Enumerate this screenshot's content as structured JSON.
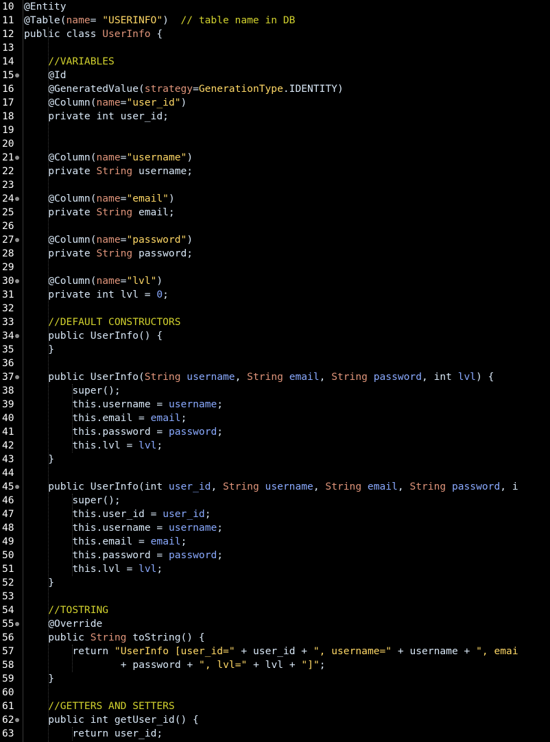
{
  "editor": {
    "theme": {
      "background": "#000000",
      "line_number": "#ffffff",
      "plain": "#d9e8f7",
      "keyword": "#d9e8f7",
      "string": "#ec7600",
      "comment": "#d2d22e",
      "type": "#e0957b",
      "param": "#79abff",
      "class_name": "#e0957b",
      "fold_marker": "#8f8f8f"
    },
    "lines": [
      {
        "n": "10",
        "fold": false,
        "indent": 0,
        "tokens": [
          [
            "@Entity",
            "plain"
          ]
        ]
      },
      {
        "n": "11",
        "fold": false,
        "indent": 0,
        "tokens": [
          [
            "@Table(",
            "plain"
          ],
          [
            "name",
            "type"
          ],
          [
            "= ",
            "plain"
          ],
          [
            "\"USERINFO\"",
            "yellow"
          ],
          [
            ")  ",
            "plain"
          ],
          [
            "// table name in DB",
            "comment"
          ]
        ]
      },
      {
        "n": "12",
        "fold": false,
        "indent": 0,
        "tokens": [
          [
            "public class ",
            "plain"
          ],
          [
            "UserInfo",
            "type"
          ],
          [
            " {",
            "plain"
          ]
        ]
      },
      {
        "n": "13",
        "fold": false,
        "indent": 0,
        "tokens": []
      },
      {
        "n": "14",
        "fold": false,
        "indent": 1,
        "tokens": [
          [
            "//VARIABLES",
            "comment"
          ]
        ]
      },
      {
        "n": "15",
        "fold": true,
        "indent": 1,
        "tokens": [
          [
            "@Id",
            "plain"
          ]
        ]
      },
      {
        "n": "16",
        "fold": false,
        "indent": 1,
        "tokens": [
          [
            "@GeneratedValue(",
            "plain"
          ],
          [
            "strategy",
            "type"
          ],
          [
            "=",
            "plain"
          ],
          [
            "GenerationType",
            "yellow"
          ],
          [
            ".IDENTITY)",
            "plain"
          ]
        ]
      },
      {
        "n": "17",
        "fold": false,
        "indent": 1,
        "tokens": [
          [
            "@Column(",
            "plain"
          ],
          [
            "name",
            "type"
          ],
          [
            "=",
            "plain"
          ],
          [
            "\"user_id\"",
            "yellow"
          ],
          [
            ")",
            "plain"
          ]
        ]
      },
      {
        "n": "18",
        "fold": false,
        "indent": 1,
        "tokens": [
          [
            "private int user_id;",
            "plain"
          ]
        ]
      },
      {
        "n": "19",
        "fold": false,
        "indent": 0,
        "tokens": []
      },
      {
        "n": "20",
        "fold": false,
        "indent": 0,
        "tokens": []
      },
      {
        "n": "21",
        "fold": true,
        "indent": 1,
        "tokens": [
          [
            "@Column(",
            "plain"
          ],
          [
            "name",
            "type"
          ],
          [
            "=",
            "plain"
          ],
          [
            "\"username\"",
            "yellow"
          ],
          [
            ")",
            "plain"
          ]
        ]
      },
      {
        "n": "22",
        "fold": false,
        "indent": 1,
        "tokens": [
          [
            "private ",
            "plain"
          ],
          [
            "String",
            "type"
          ],
          [
            " username;",
            "plain"
          ]
        ]
      },
      {
        "n": "23",
        "fold": false,
        "indent": 0,
        "tokens": []
      },
      {
        "n": "24",
        "fold": true,
        "indent": 1,
        "tokens": [
          [
            "@Column(",
            "plain"
          ],
          [
            "name",
            "type"
          ],
          [
            "=",
            "plain"
          ],
          [
            "\"email\"",
            "yellow"
          ],
          [
            ")",
            "plain"
          ]
        ]
      },
      {
        "n": "25",
        "fold": false,
        "indent": 1,
        "tokens": [
          [
            "private ",
            "plain"
          ],
          [
            "String",
            "type"
          ],
          [
            " email;",
            "plain"
          ]
        ]
      },
      {
        "n": "26",
        "fold": false,
        "indent": 0,
        "tokens": []
      },
      {
        "n": "27",
        "fold": true,
        "indent": 1,
        "tokens": [
          [
            "@Column(",
            "plain"
          ],
          [
            "name",
            "type"
          ],
          [
            "=",
            "plain"
          ],
          [
            "\"password\"",
            "yellow"
          ],
          [
            ")",
            "plain"
          ]
        ]
      },
      {
        "n": "28",
        "fold": false,
        "indent": 1,
        "tokens": [
          [
            "private ",
            "plain"
          ],
          [
            "String",
            "type"
          ],
          [
            " password;",
            "plain"
          ]
        ]
      },
      {
        "n": "29",
        "fold": false,
        "indent": 0,
        "tokens": []
      },
      {
        "n": "30",
        "fold": true,
        "indent": 1,
        "tokens": [
          [
            "@Column(",
            "plain"
          ],
          [
            "name",
            "type"
          ],
          [
            "=",
            "plain"
          ],
          [
            "\"lvl\"",
            "yellow"
          ],
          [
            ")",
            "plain"
          ]
        ]
      },
      {
        "n": "31",
        "fold": false,
        "indent": 1,
        "tokens": [
          [
            "private int lvl = ",
            "plain"
          ],
          [
            "0",
            "param"
          ],
          [
            ";",
            "plain"
          ]
        ]
      },
      {
        "n": "32",
        "fold": false,
        "indent": 0,
        "tokens": []
      },
      {
        "n": "33",
        "fold": false,
        "indent": 1,
        "tokens": [
          [
            "//DEFAULT CONSTRUCTORS",
            "comment"
          ]
        ]
      },
      {
        "n": "34",
        "fold": true,
        "indent": 1,
        "tokens": [
          [
            "public UserInfo() {",
            "plain"
          ]
        ]
      },
      {
        "n": "35",
        "fold": false,
        "indent": 1,
        "tokens": [
          [
            "}",
            "plain"
          ]
        ]
      },
      {
        "n": "36",
        "fold": false,
        "indent": 0,
        "tokens": []
      },
      {
        "n": "37",
        "fold": true,
        "indent": 1,
        "tokens": [
          [
            "public UserInfo(",
            "plain"
          ],
          [
            "String",
            "type"
          ],
          [
            " ",
            "plain"
          ],
          [
            "username",
            "param"
          ],
          [
            ", ",
            "plain"
          ],
          [
            "String",
            "type"
          ],
          [
            " ",
            "plain"
          ],
          [
            "email",
            "param"
          ],
          [
            ", ",
            "plain"
          ],
          [
            "String",
            "type"
          ],
          [
            " ",
            "plain"
          ],
          [
            "password",
            "param"
          ],
          [
            ", int ",
            "plain"
          ],
          [
            "lvl",
            "param"
          ],
          [
            ") {",
            "plain"
          ]
        ]
      },
      {
        "n": "38",
        "fold": false,
        "indent": 2,
        "tokens": [
          [
            "super();",
            "plain"
          ]
        ]
      },
      {
        "n": "39",
        "fold": false,
        "indent": 2,
        "tokens": [
          [
            "this.username = ",
            "plain"
          ],
          [
            "username",
            "param"
          ],
          [
            ";",
            "plain"
          ]
        ]
      },
      {
        "n": "40",
        "fold": false,
        "indent": 2,
        "tokens": [
          [
            "this.email = ",
            "plain"
          ],
          [
            "email",
            "param"
          ],
          [
            ";",
            "plain"
          ]
        ]
      },
      {
        "n": "41",
        "fold": false,
        "indent": 2,
        "tokens": [
          [
            "this.password = ",
            "plain"
          ],
          [
            "password",
            "param"
          ],
          [
            ";",
            "plain"
          ]
        ]
      },
      {
        "n": "42",
        "fold": false,
        "indent": 2,
        "tokens": [
          [
            "this.lvl = ",
            "plain"
          ],
          [
            "lvl",
            "param"
          ],
          [
            ";",
            "plain"
          ]
        ]
      },
      {
        "n": "43",
        "fold": false,
        "indent": 1,
        "tokens": [
          [
            "}",
            "plain"
          ]
        ]
      },
      {
        "n": "44",
        "fold": false,
        "indent": 0,
        "tokens": []
      },
      {
        "n": "45",
        "fold": true,
        "indent": 1,
        "tokens": [
          [
            "public UserInfo(int ",
            "plain"
          ],
          [
            "user_id",
            "param"
          ],
          [
            ", ",
            "plain"
          ],
          [
            "String",
            "type"
          ],
          [
            " ",
            "plain"
          ],
          [
            "username",
            "param"
          ],
          [
            ", ",
            "plain"
          ],
          [
            "String",
            "type"
          ],
          [
            " ",
            "plain"
          ],
          [
            "email",
            "param"
          ],
          [
            ", ",
            "plain"
          ],
          [
            "String",
            "type"
          ],
          [
            " ",
            "plain"
          ],
          [
            "password",
            "param"
          ],
          [
            ", i",
            "plain"
          ]
        ]
      },
      {
        "n": "46",
        "fold": false,
        "indent": 2,
        "tokens": [
          [
            "super();",
            "plain"
          ]
        ]
      },
      {
        "n": "47",
        "fold": false,
        "indent": 2,
        "tokens": [
          [
            "this.user_id = ",
            "plain"
          ],
          [
            "user_id",
            "param"
          ],
          [
            ";",
            "plain"
          ]
        ]
      },
      {
        "n": "48",
        "fold": false,
        "indent": 2,
        "tokens": [
          [
            "this.username = ",
            "plain"
          ],
          [
            "username",
            "param"
          ],
          [
            ";",
            "plain"
          ]
        ]
      },
      {
        "n": "49",
        "fold": false,
        "indent": 2,
        "tokens": [
          [
            "this.email = ",
            "plain"
          ],
          [
            "email",
            "param"
          ],
          [
            ";",
            "plain"
          ]
        ]
      },
      {
        "n": "50",
        "fold": false,
        "indent": 2,
        "tokens": [
          [
            "this.password = ",
            "plain"
          ],
          [
            "password",
            "param"
          ],
          [
            ";",
            "plain"
          ]
        ]
      },
      {
        "n": "51",
        "fold": false,
        "indent": 2,
        "tokens": [
          [
            "this.lvl = ",
            "plain"
          ],
          [
            "lvl",
            "param"
          ],
          [
            ";",
            "plain"
          ]
        ]
      },
      {
        "n": "52",
        "fold": false,
        "indent": 1,
        "tokens": [
          [
            "}",
            "plain"
          ]
        ]
      },
      {
        "n": "53",
        "fold": false,
        "indent": 0,
        "tokens": []
      },
      {
        "n": "54",
        "fold": false,
        "indent": 1,
        "tokens": [
          [
            "//TOSTRING",
            "comment"
          ]
        ]
      },
      {
        "n": "55",
        "fold": true,
        "indent": 1,
        "tokens": [
          [
            "@Override",
            "plain"
          ]
        ]
      },
      {
        "n": "56",
        "fold": false,
        "indent": 1,
        "tokens": [
          [
            "public ",
            "plain"
          ],
          [
            "String",
            "type"
          ],
          [
            " toString() {",
            "plain"
          ]
        ]
      },
      {
        "n": "57",
        "fold": false,
        "indent": 2,
        "tokens": [
          [
            "return ",
            "plain"
          ],
          [
            "\"UserInfo [user_id=\"",
            "yellow"
          ],
          [
            " + user_id + ",
            "plain"
          ],
          [
            "\", username=\"",
            "yellow"
          ],
          [
            " + username + ",
            "plain"
          ],
          [
            "\", emai",
            "yellow"
          ]
        ]
      },
      {
        "n": "58",
        "fold": false,
        "indent": 4,
        "tokens": [
          [
            "+ password + ",
            "plain"
          ],
          [
            "\", lvl=\"",
            "yellow"
          ],
          [
            " + lvl + ",
            "plain"
          ],
          [
            "\"]\"",
            "yellow"
          ],
          [
            ";",
            "plain"
          ]
        ]
      },
      {
        "n": "59",
        "fold": false,
        "indent": 1,
        "tokens": [
          [
            "}",
            "plain"
          ]
        ]
      },
      {
        "n": "60",
        "fold": false,
        "indent": 0,
        "tokens": []
      },
      {
        "n": "61",
        "fold": false,
        "indent": 1,
        "tokens": [
          [
            "//GETTERS AND SETTERS",
            "comment"
          ]
        ]
      },
      {
        "n": "62",
        "fold": true,
        "indent": 1,
        "tokens": [
          [
            "public int getUser_id() {",
            "plain"
          ]
        ]
      },
      {
        "n": "63",
        "fold": false,
        "indent": 2,
        "tokens": [
          [
            "return user_id;",
            "plain"
          ]
        ]
      }
    ]
  }
}
